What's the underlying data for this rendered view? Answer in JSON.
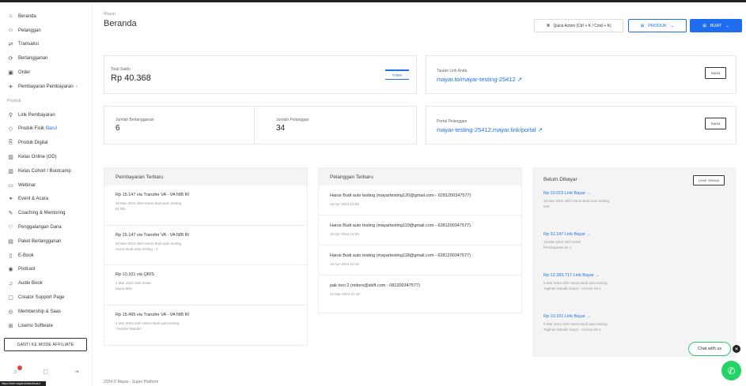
{
  "sidebar": {
    "items": [
      {
        "icon": "home-icon",
        "glyph": "⌂",
        "label": "Beranda"
      },
      {
        "icon": "users-icon",
        "glyph": "☺",
        "label": "Pelanggan"
      },
      {
        "icon": "transaction-icon",
        "glyph": "⇄",
        "label": "Transaksi"
      },
      {
        "icon": "subscription-icon",
        "glyph": "⟳",
        "label": "Berlangganan"
      },
      {
        "icon": "order-icon",
        "glyph": "▣",
        "label": "Order"
      },
      {
        "icon": "payment-settings-icon",
        "glyph": "✈",
        "label": "Pembayaran Pembayaran",
        "arrow": "›"
      }
    ],
    "section_label": "Produk",
    "product_items": [
      {
        "icon": "link-icon",
        "glyph": "⚲",
        "label": "Link Pembayaran"
      },
      {
        "icon": "tag-icon",
        "glyph": "◇",
        "label": "Produk Fisik",
        "badge": "Baru!"
      },
      {
        "icon": "digital-icon",
        "glyph": "⎘",
        "label": "Produk Digital"
      },
      {
        "icon": "class-icon",
        "glyph": "▥",
        "label": "Kelas Online (OD)"
      },
      {
        "icon": "cohort-icon",
        "glyph": "▥",
        "label": "Kelas Cohort / Bootcamp"
      },
      {
        "icon": "webinar-icon",
        "glyph": "▭",
        "label": "Webinar"
      },
      {
        "icon": "event-icon",
        "glyph": "⚭",
        "label": "Event & Acara"
      },
      {
        "icon": "coaching-icon",
        "glyph": "✎",
        "label": "Coaching & Mentoring"
      },
      {
        "icon": "fundraising-icon",
        "glyph": "♡",
        "label": "Penggalangan Dana"
      },
      {
        "icon": "subscription-pkg-icon",
        "glyph": "▤",
        "label": "Paket Berlangganan"
      },
      {
        "icon": "ebook-icon",
        "glyph": "▯",
        "label": "E-Book"
      },
      {
        "icon": "podcast-icon",
        "glyph": "◉",
        "label": "Podcast"
      },
      {
        "icon": "audiobook-icon",
        "glyph": "♫",
        "label": "Audio Book"
      },
      {
        "icon": "creator-support-icon",
        "glyph": "▢",
        "label": "Creator Support Page"
      },
      {
        "icon": "membership-icon",
        "glyph": "◎",
        "label": "Membership & Saas"
      },
      {
        "icon": "software-icon",
        "glyph": "⊞",
        "label": "Lisensi Software"
      }
    ],
    "affiliate_button": "GANTI KE MODE AFFILIATE",
    "status_tip": "https://web.mayar.id/dashboard"
  },
  "header": {
    "breadcrumb": "Mayar",
    "title": "Beranda",
    "quick_action": "Quick Action (Ctrl + K / Cmd + K)",
    "produk_btn": "PRODUK",
    "buat_btn": "BUAT"
  },
  "stats": {
    "saldo_label": "Total Saldo",
    "saldo_value": "Rp 40.368",
    "tarik_btn": "TARIK",
    "link_label": "Tautan Link Anda",
    "link_value": "mayar.to/mayar-testing-25412",
    "copy_btn": "SALIN",
    "transaksi_label": "Jumlah Berlangganan",
    "transaksi_value": "6",
    "pelanggan_label": "Jumlah Pelanggan",
    "pelanggan_value": "34",
    "portal_label": "Portal Pelanggan",
    "portal_value": "mayar-testing-25412.mayar.link/portal",
    "copy_btn2": "SALIN"
  },
  "payments": {
    "title": "Pembayaran Terbaru",
    "items": [
      {
        "title": "Rp 15.147 via Transfer VA - VA NIB RI",
        "sub": "25 Mar 2024 oleh Harus Budi auto testing",
        "sub2": "ini link"
      },
      {
        "title": "Rp 15.147 via Transfer VA - VA NIB RI",
        "sub": "25 Mar 2024 oleh Harus Budi auto testing",
        "sub2": "Harus Budi auto testing - 4"
      },
      {
        "title": "Rp 10.101 via QRIS",
        "sub": "1 Mar 2024 oleh tester",
        "sub2": "bayar dulu"
      },
      {
        "title": "Rp 15.495 via Transfer VA - VA NIB RI",
        "sub": "1 Mar 2024 oleh Harus Budi auto testing",
        "sub2": "Transfer Mandiri"
      }
    ]
  },
  "customers": {
    "title": "Pelanggan Terbaru",
    "items": [
      {
        "title": "Harus Budi auto testing (mayartesting120@gmail.com - 6281200347577)",
        "sub": "18 Apr 2024 12:59"
      },
      {
        "title": "Harus Budi auto testing (mayartesting119@gmail.com - 6281200347577)",
        "sub": "18 Apr 2024 12:55"
      },
      {
        "title": "Harus Budi auto testing (mayartesting118@gmail.com - 6281200347577)",
        "sub": "18 Apr 2024 12:18"
      },
      {
        "title": "pak toro 2 (mitoro@skift.com - 081200347577)",
        "sub": "24 Mar 2024 21:28"
      }
    ]
  },
  "unpaid": {
    "title": "Belum Dibayar",
    "view_all": "LIHAT SEMUA",
    "items": [
      {
        "title": "Rp 10.015 Link Bayar →",
        "sub": "18 Mar 2024 oleh Harus Budi auto testing",
        "sub2": "test"
      },
      {
        "title": "Rp 31.147 Link Bayar →",
        "sub": "15 Mar 2024 oleh tester",
        "sub2": "Pembayaran ke 1"
      },
      {
        "title": "Rp 12.283.717 Link Bayar →",
        "sub": "6 Mar 2024 oleh Harus Budi auto testing",
        "sub2": "Tagihan Mandiri bayar - Invoice 28.4"
      },
      {
        "title": "Rp 10.101 Link Bayar →",
        "sub": "6 Mar 2024 oleh Harus Budi auto testing",
        "sub2": "Tagihan Mandiri bayar - Invoice 28.4"
      }
    ]
  },
  "footer": "2024 © Mayar - Super Platform",
  "chat": {
    "label": "Chat with us",
    "close": "✕",
    "wa": "✆"
  },
  "colors": {
    "accent": "#1f6ef0",
    "whatsapp": "#25d366"
  }
}
